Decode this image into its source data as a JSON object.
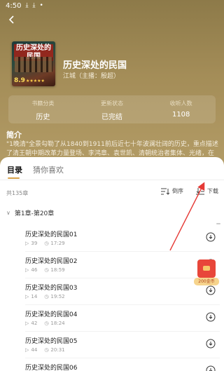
{
  "status_bar": {
    "time": "4:50"
  },
  "book": {
    "cover_title": "历史深处的民国",
    "cover_score": "8.9",
    "cover_stars": "★★★★★",
    "title": "历史深处的民国",
    "author": "江城（主播：殷超）"
  },
  "stats": [
    {
      "label": "书籍分类",
      "value": "历史"
    },
    {
      "label": "更新状态",
      "value": "已完结"
    },
    {
      "label": "收听人数",
      "value": "1108"
    }
  ],
  "intro": {
    "heading": "简介",
    "text": "\"1晚清\"全景勾勒了从1840到1911前后近七十年波澜壮阔的历史，重点描述了清王朝中期改革力量登场、李鸿章、袁世凯、清朝统治者集体、光绪，在野力量革命"
  },
  "tabs": [
    {
      "label": "目录",
      "active": true
    },
    {
      "label": "猜你喜欢",
      "active": false
    }
  ],
  "toolbar": {
    "count": "共135章",
    "sort_label": "倒序",
    "download_label": "下载"
  },
  "group": {
    "label": "第1章-第20章"
  },
  "chapters": [
    {
      "title": "历史深处的民国01",
      "plays": "39",
      "duration": "17:29"
    },
    {
      "title": "历史深处的民国02",
      "plays": "46",
      "duration": "18:59"
    },
    {
      "title": "历史深处的民国03",
      "plays": "14",
      "duration": "19:52"
    },
    {
      "title": "历史深处的民国04",
      "plays": "42",
      "duration": "18:24"
    },
    {
      "title": "历史深处的民国05",
      "plays": "44",
      "duration": "20:31"
    },
    {
      "title": "历史深处的民国06",
      "plays": "",
      "duration": ""
    }
  ],
  "red_packet": {
    "label": "200金币"
  },
  "colors": {
    "accent": "#d8a24a",
    "hero": "#a48d58",
    "annotation_arrow": "#e53935"
  }
}
